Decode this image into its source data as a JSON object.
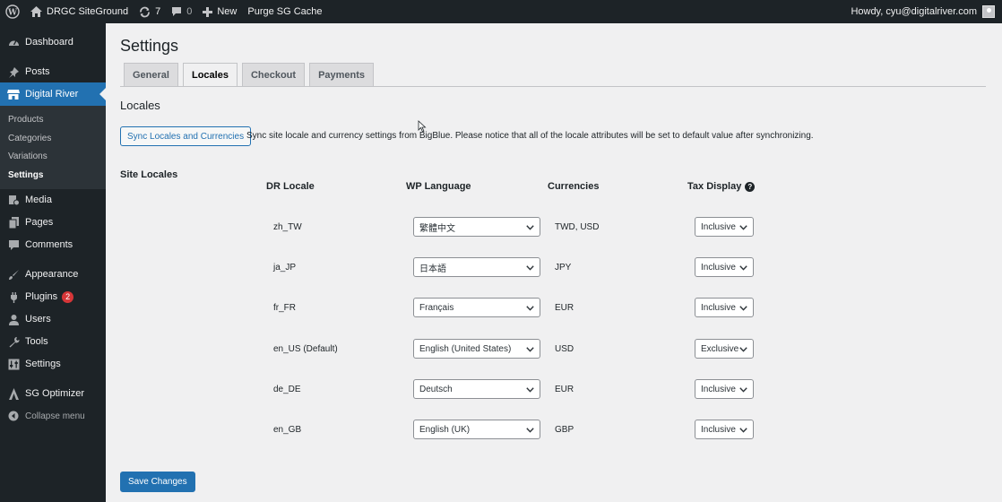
{
  "admin_bar": {
    "site_name": "DRGC SiteGround",
    "updates_count": "7",
    "comments_count": "0",
    "new_label": "New",
    "purge_label": "Purge SG Cache",
    "howdy": "Howdy, cyu@digitalriver.com"
  },
  "sidebar": {
    "dashboard": "Dashboard",
    "posts": "Posts",
    "digital_river": "Digital River",
    "sub": {
      "products": "Products",
      "categories": "Categories",
      "variations": "Variations",
      "settings": "Settings"
    },
    "media": "Media",
    "pages": "Pages",
    "comments": "Comments",
    "appearance": "Appearance",
    "plugins": "Plugins",
    "plugins_badge": "2",
    "users": "Users",
    "tools": "Tools",
    "settings": "Settings",
    "sg_optimizer": "SG Optimizer",
    "collapse": "Collapse menu"
  },
  "page": {
    "title": "Settings",
    "tabs": [
      "General",
      "Locales",
      "Checkout",
      "Payments"
    ],
    "section_title": "Locales",
    "sync_button": "Sync Locales and Currencies",
    "sync_description": "Sync site locale and currency settings from BigBlue. Please notice that all of the locale attributes will be set to default value after synchronizing.",
    "site_locales_label": "Site Locales",
    "columns": {
      "dr_locale": "DR Locale",
      "wp_language": "WP Language",
      "currencies": "Currencies",
      "tax_display": "Tax Display"
    },
    "help_icon_glyph": "?",
    "rows": [
      {
        "locale": "zh_TW",
        "language": "繁體中文",
        "currencies": "TWD, USD",
        "tax": "Inclusive"
      },
      {
        "locale": "ja_JP",
        "language": "日本語",
        "currencies": "JPY",
        "tax": "Inclusive"
      },
      {
        "locale": "fr_FR",
        "language": "Français",
        "currencies": "EUR",
        "tax": "Inclusive"
      },
      {
        "locale": "en_US (Default)",
        "language": "English (United States)",
        "currencies": "USD",
        "tax": "Exclusive"
      },
      {
        "locale": "de_DE",
        "language": "Deutsch",
        "currencies": "EUR",
        "tax": "Inclusive"
      },
      {
        "locale": "en_GB",
        "language": "English (UK)",
        "currencies": "GBP",
        "tax": "Inclusive"
      }
    ],
    "save_button": "Save Changes"
  },
  "colors": {
    "accent": "#2271b1",
    "admin_dark": "#1d2327",
    "badge": "#d63638"
  }
}
